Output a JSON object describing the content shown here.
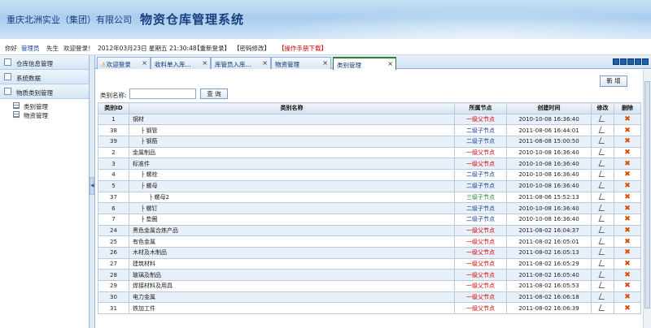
{
  "header": {
    "company": "重庆北洲实业（集团）有限公司",
    "system": "物资仓库管理系统"
  },
  "userbar": {
    "greeting": "你好",
    "username": "管理员",
    "suffix": "先生",
    "welcome": "欢迎登录！",
    "datetime": "2012年03月23日 星期五 21:30:48",
    "relogin": "【重新登录】",
    "change_password": "【密码修改】",
    "manual_download": "【操作手册下载】"
  },
  "sidebar": {
    "sections": [
      {
        "label": "仓库信息管理"
      },
      {
        "label": "系统数据"
      },
      {
        "label": "物质类别管理"
      }
    ],
    "items": [
      {
        "label": "类别管理"
      },
      {
        "label": "物资管理"
      }
    ]
  },
  "tabs": [
    {
      "label": "欢迎登录"
    },
    {
      "label": "收料单入库..."
    },
    {
      "label": "库管员入库..."
    },
    {
      "label": "物资管理"
    },
    {
      "label": "类别管理"
    }
  ],
  "toolbar": {
    "add_label": "新 增"
  },
  "search": {
    "label": "类别名称:",
    "value": "",
    "button": "查 询"
  },
  "table": {
    "headers": [
      "类别ID",
      "类别名称",
      "所属节点",
      "创建时间",
      "修改",
      "删除"
    ],
    "rows": [
      {
        "id": "1",
        "name": "钢材",
        "indent": 0,
        "node": "一级父节点",
        "nodeType": "red",
        "time": "2010-10-08 16:36:40"
      },
      {
        "id": "38",
        "name": "├ 钢管",
        "indent": 1,
        "node": "二级子节点",
        "nodeType": "blue",
        "time": "2011-08-06 16:44:01"
      },
      {
        "id": "39",
        "name": "├ 钢筋",
        "indent": 1,
        "node": "二级子节点",
        "nodeType": "blue",
        "time": "2011-08-08 15:00:50"
      },
      {
        "id": "2",
        "name": "金属制品",
        "indent": 0,
        "node": "一级父节点",
        "nodeType": "red",
        "time": "2010-10-08 16:36:40"
      },
      {
        "id": "3",
        "name": "标准件",
        "indent": 0,
        "node": "一级父节点",
        "nodeType": "red",
        "time": "2010-10-08 16:36:40"
      },
      {
        "id": "4",
        "name": "├ 螺栓",
        "indent": 1,
        "node": "二级子节点",
        "nodeType": "blue",
        "time": "2010-10-08 16:36:40"
      },
      {
        "id": "5",
        "name": "├ 螺母",
        "indent": 1,
        "node": "二级子节点",
        "nodeType": "blue",
        "time": "2010-10-08 16:36:40"
      },
      {
        "id": "37",
        "name": "├ 螺母2",
        "indent": 2,
        "node": "三级子节点",
        "nodeType": "green",
        "time": "2011-08-06 15:52:13"
      },
      {
        "id": "6",
        "name": "├ 螺钉",
        "indent": 1,
        "node": "二级子节点",
        "nodeType": "blue",
        "time": "2010-10-08 16:36:40"
      },
      {
        "id": "7",
        "name": "├ 垫圈",
        "indent": 1,
        "node": "二级子节点",
        "nodeType": "blue",
        "time": "2010-10-08 16:36:40"
      },
      {
        "id": "24",
        "name": "黑色金属合炼产品",
        "indent": 0,
        "node": "一级父节点",
        "nodeType": "red",
        "time": "2011-08-02 16:04:37"
      },
      {
        "id": "25",
        "name": "有色金属",
        "indent": 0,
        "node": "一级父节点",
        "nodeType": "red",
        "time": "2011-08-02 16:05:01"
      },
      {
        "id": "26",
        "name": "木材及木制品",
        "indent": 0,
        "node": "一级父节点",
        "nodeType": "red",
        "time": "2011-08-02 16:05:13"
      },
      {
        "id": "27",
        "name": "建筑材料",
        "indent": 0,
        "node": "一级父节点",
        "nodeType": "red",
        "time": "2011-08-02 16:05:29"
      },
      {
        "id": "28",
        "name": "玻璃及制品",
        "indent": 0,
        "node": "一级父节点",
        "nodeType": "red",
        "time": "2011-08-02 16:05:40"
      },
      {
        "id": "29",
        "name": "焊接材料及用具",
        "indent": 0,
        "node": "一级父节点",
        "nodeType": "red",
        "time": "2011-08-02 16:05:53"
      },
      {
        "id": "30",
        "name": "电力金属",
        "indent": 0,
        "node": "一级父节点",
        "nodeType": "red",
        "time": "2011-08-02 16:06:18"
      },
      {
        "id": "31",
        "name": "铁加工件",
        "indent": 0,
        "node": "一级父节点",
        "nodeType": "red",
        "time": "2011-08-02 16:06:39"
      }
    ]
  },
  "colors": {
    "accent": "#16407e",
    "red_node": "#d40000",
    "blue_node": "#1a3f9a",
    "green_node": "#1b8a2a"
  }
}
